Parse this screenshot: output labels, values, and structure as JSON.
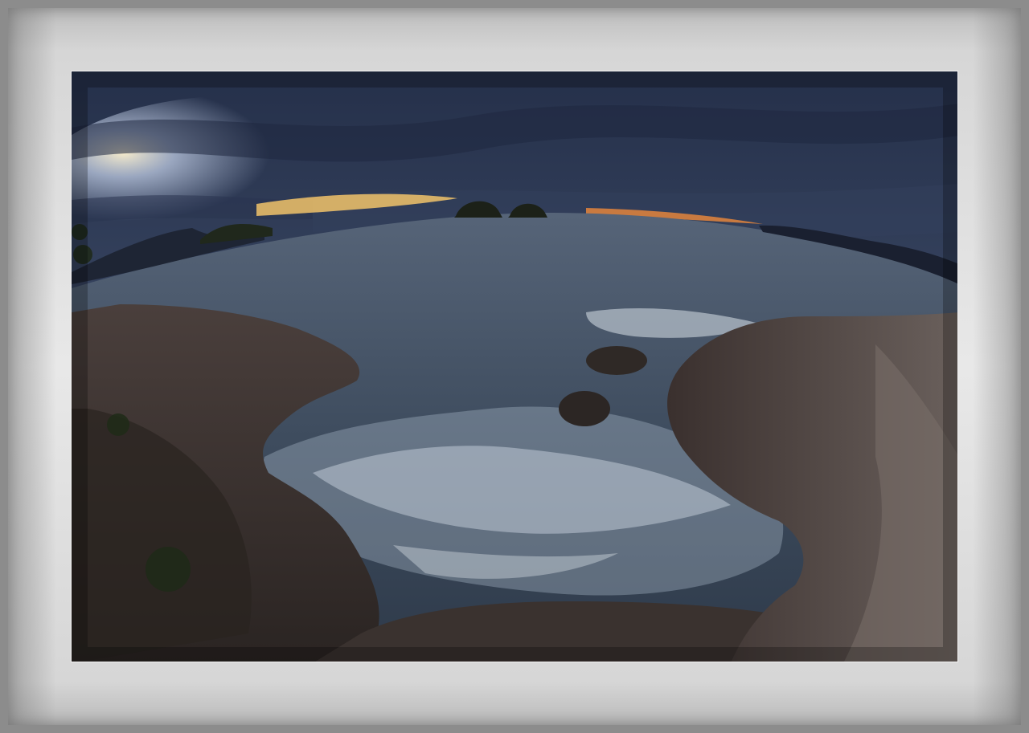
{
  "scene": {
    "subject": "seascape-sunset-fisheye",
    "colors": {
      "sky_top": "#2b3650",
      "sky_mid": "#4a5a78",
      "sunset_glow": "#f0c060",
      "sea": "#3d4c60",
      "foam": "#dfe6ee",
      "rock": "#3a3230",
      "frame": "#8c8c8c",
      "mat": "#e2e2e2"
    }
  }
}
